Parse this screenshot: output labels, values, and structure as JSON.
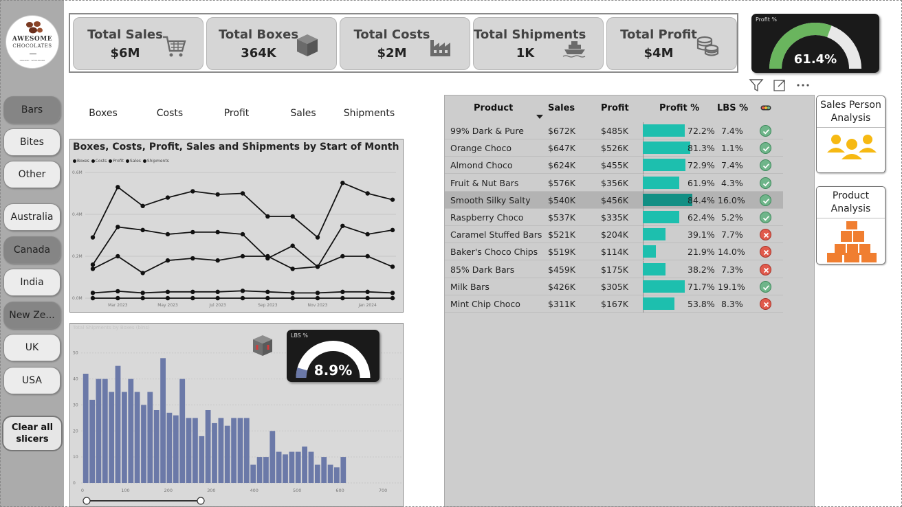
{
  "logo": {
    "line1": "AWESOME",
    "line2": "CHOCOLATES",
    "line3": "ORGANIC · WHOLESOME"
  },
  "slicers": {
    "categories": [
      {
        "label": "Bars",
        "selected": true
      },
      {
        "label": "Bites",
        "selected": false
      },
      {
        "label": "Other",
        "selected": false
      }
    ],
    "countries": [
      {
        "label": "Australia",
        "selected": false
      },
      {
        "label": "Canada",
        "selected": true
      },
      {
        "label": "India",
        "selected": false
      },
      {
        "label": "New Ze...",
        "selected": true
      },
      {
        "label": "UK",
        "selected": false
      },
      {
        "label": "USA",
        "selected": false
      }
    ],
    "clear_label": [
      "Clear all",
      "slicers"
    ]
  },
  "kpis": [
    {
      "title": "Total Sales",
      "value": "$6M",
      "icon": "cart-icon"
    },
    {
      "title": "Total Boxes",
      "value": "364K",
      "icon": "box-icon"
    },
    {
      "title": "Total Costs",
      "value": "$2M",
      "icon": "factory-icon"
    },
    {
      "title": "Total Shipments",
      "value": "1K",
      "icon": "ship-icon"
    },
    {
      "title": "Total Profit",
      "value": "$4M",
      "icon": "coins-icon"
    }
  ],
  "profit_gauge": {
    "label": "Profit %",
    "value_text": "61.4%",
    "value": 61.4,
    "max": 100
  },
  "measures": [
    "Boxes",
    "Costs",
    "Profit",
    "Sales",
    "Shipments"
  ],
  "chart_data": [
    {
      "type": "line",
      "title": "Boxes, Costs, Profit, Sales and Shipments by Start of Month",
      "legend": [
        "Boxes",
        "Costs",
        "Profit",
        "Sales",
        "Shipments"
      ],
      "x_ticks": [
        "Mar 2023",
        "May 2023",
        "Jul 2023",
        "Sep 2023",
        "Nov 2023",
        "Jan 2024"
      ],
      "y_ticks": [
        "0.0M",
        "0.2M",
        "0.4M",
        "0.6M"
      ],
      "ylim": [
        0,
        0.6
      ],
      "x": [
        "2023-01",
        "2023-02",
        "2023-03",
        "2023-04",
        "2023-05",
        "2023-06",
        "2023-07",
        "2023-08",
        "2023-09",
        "2023-10",
        "2023-11",
        "2023-12",
        "2024-01",
        "2024-02"
      ],
      "series": [
        {
          "name": "Sales",
          "values": [
            0.29,
            0.53,
            0.44,
            0.48,
            0.51,
            0.495,
            0.5,
            0.39,
            0.39,
            0.29,
            0.55,
            0.5,
            0.47
          ]
        },
        {
          "name": "Profit",
          "values": [
            0.16,
            0.34,
            0.325,
            0.305,
            0.315,
            0.315,
            0.305,
            0.19,
            0.25,
            0.15,
            0.345,
            0.305,
            0.325
          ]
        },
        {
          "name": "Costs",
          "values": [
            0.14,
            0.2,
            0.12,
            0.18,
            0.19,
            0.18,
            0.2,
            0.2,
            0.14,
            0.15,
            0.2,
            0.2,
            0.15
          ]
        },
        {
          "name": "Boxes",
          "values": [
            0.025,
            0.033,
            0.025,
            0.03,
            0.03,
            0.03,
            0.035,
            0.03,
            0.025,
            0.025,
            0.03,
            0.03,
            0.025
          ]
        },
        {
          "name": "Shipments",
          "values": [
            0.0,
            0.0,
            0.0,
            0.0,
            0.0,
            0.0,
            0.0,
            0.0,
            0.0,
            0.0,
            0.0,
            0.0,
            0.0
          ]
        }
      ]
    },
    {
      "type": "bar",
      "title": "Total Shipments by Boxes (bins)",
      "x_ticks": [
        0,
        100,
        200,
        300,
        400,
        500,
        600,
        700
      ],
      "y_ticks": [
        0,
        10,
        20,
        30,
        40,
        50
      ],
      "xlim": [
        0,
        740
      ],
      "ylim": [
        0,
        56
      ],
      "bin_width": 15,
      "values": [
        42,
        32,
        40,
        40,
        35,
        45,
        35,
        40,
        35,
        30,
        35,
        28,
        48,
        27,
        26,
        40,
        25,
        25,
        18,
        28,
        23,
        25,
        22,
        25,
        25,
        25,
        7,
        10,
        10,
        20,
        12,
        11,
        12,
        12,
        14,
        12,
        7,
        10,
        7,
        6,
        10
      ]
    }
  ],
  "lbs_gauge": {
    "label": "LBS %",
    "value_text": "8.9%",
    "value": 8.9,
    "max": 100
  },
  "table": {
    "headers": [
      "Product",
      "Sales",
      "Profit",
      "Profit %",
      "LBS %"
    ],
    "rows": [
      {
        "product": "99% Dark & Pure",
        "sales": "$672K",
        "profit": "$485K",
        "profit_pct": "72.2%",
        "profit_val": 72.2,
        "lbs": "7.4%",
        "status": "ok"
      },
      {
        "product": "Orange Choco",
        "sales": "$647K",
        "profit": "$526K",
        "profit_pct": "81.3%",
        "profit_val": 81.3,
        "lbs": "1.1%",
        "status": "ok"
      },
      {
        "product": "Almond Choco",
        "sales": "$624K",
        "profit": "$455K",
        "profit_pct": "72.9%",
        "profit_val": 72.9,
        "lbs": "7.4%",
        "status": "ok"
      },
      {
        "product": "Fruit & Nut Bars",
        "sales": "$576K",
        "profit": "$356K",
        "profit_pct": "61.9%",
        "profit_val": 61.9,
        "lbs": "4.3%",
        "status": "ok"
      },
      {
        "product": "Smooth Silky Salty",
        "sales": "$540K",
        "profit": "$456K",
        "profit_pct": "84.4%",
        "profit_val": 84.4,
        "lbs": "16.0%",
        "status": "ok",
        "highlight": true
      },
      {
        "product": "Raspberry Choco",
        "sales": "$537K",
        "profit": "$335K",
        "profit_pct": "62.4%",
        "profit_val": 62.4,
        "lbs": "5.2%",
        "status": "ok"
      },
      {
        "product": "Caramel Stuffed Bars",
        "sales": "$521K",
        "profit": "$204K",
        "profit_pct": "39.1%",
        "profit_val": 39.1,
        "lbs": "7.7%",
        "status": "bad"
      },
      {
        "product": "Baker's Choco Chips",
        "sales": "$519K",
        "profit": "$114K",
        "profit_pct": "21.9%",
        "profit_val": 21.9,
        "lbs": "14.0%",
        "status": "bad"
      },
      {
        "product": "85% Dark Bars",
        "sales": "$459K",
        "profit": "$175K",
        "profit_pct": "38.2%",
        "profit_val": 38.2,
        "lbs": "7.3%",
        "status": "bad"
      },
      {
        "product": "Milk Bars",
        "sales": "$426K",
        "profit": "$305K",
        "profit_pct": "71.7%",
        "profit_val": 71.7,
        "lbs": "19.1%",
        "status": "ok"
      },
      {
        "product": "Mint Chip Choco",
        "sales": "$311K",
        "profit": "$167K",
        "profit_pct": "53.8%",
        "profit_val": 53.8,
        "lbs": "8.3%",
        "status": "bad"
      }
    ]
  },
  "nav_cards": [
    {
      "label": "Sales Person Analysis",
      "icon": "people-icon"
    },
    {
      "label": "Product Analysis",
      "icon": "boxes-icon"
    }
  ],
  "colors": {
    "accent_teal": "#1dbfae",
    "gauge_green": "#6ab55e",
    "bar_blue": "#6b79a8",
    "icon_orange": "#f07e30",
    "icon_gold": "#f6b913"
  }
}
